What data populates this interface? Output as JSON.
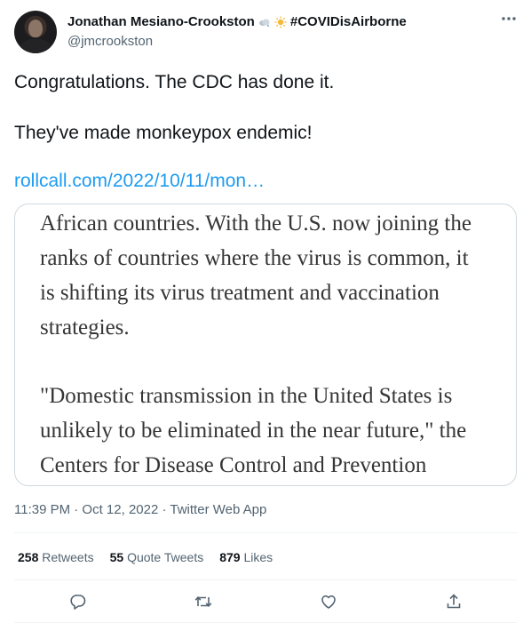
{
  "author": {
    "display_name": "Jonathan Mesiano-Crookston",
    "name_suffix": "#COVIDisAirborne",
    "handle": "@jmcrookston",
    "emoji_icons": [
      "cloud-icon",
      "sun-icon"
    ]
  },
  "tweet": {
    "text_line1": "Congratulations. The CDC has done it.",
    "text_line2": "They've made monkeypox endemic!",
    "link_text": "rollcall.com/2022/10/11/mon…",
    "media": {
      "lines": [
        "African countries. With the U.S. now joining the",
        "ranks of countries where the virus is common, it",
        "is shifting its virus treatment and vaccination",
        "strategies.",
        "\"Domestic transmission in the United States is",
        "unlikely to be eliminated in the near future,\" the",
        "Centers for Disease Control and Prevention"
      ]
    },
    "timestamp": "11:39 PM · Oct 12, 2022",
    "source": "Twitter Web App"
  },
  "stats": {
    "retweets_count": "258",
    "retweets_label": "Retweets",
    "quotes_count": "55",
    "quotes_label": "Quote Tweets",
    "likes_count": "879",
    "likes_label": "Likes"
  },
  "colors": {
    "link": "#1d9bf0",
    "secondary_text": "#536471",
    "primary_text": "#0f1419"
  }
}
